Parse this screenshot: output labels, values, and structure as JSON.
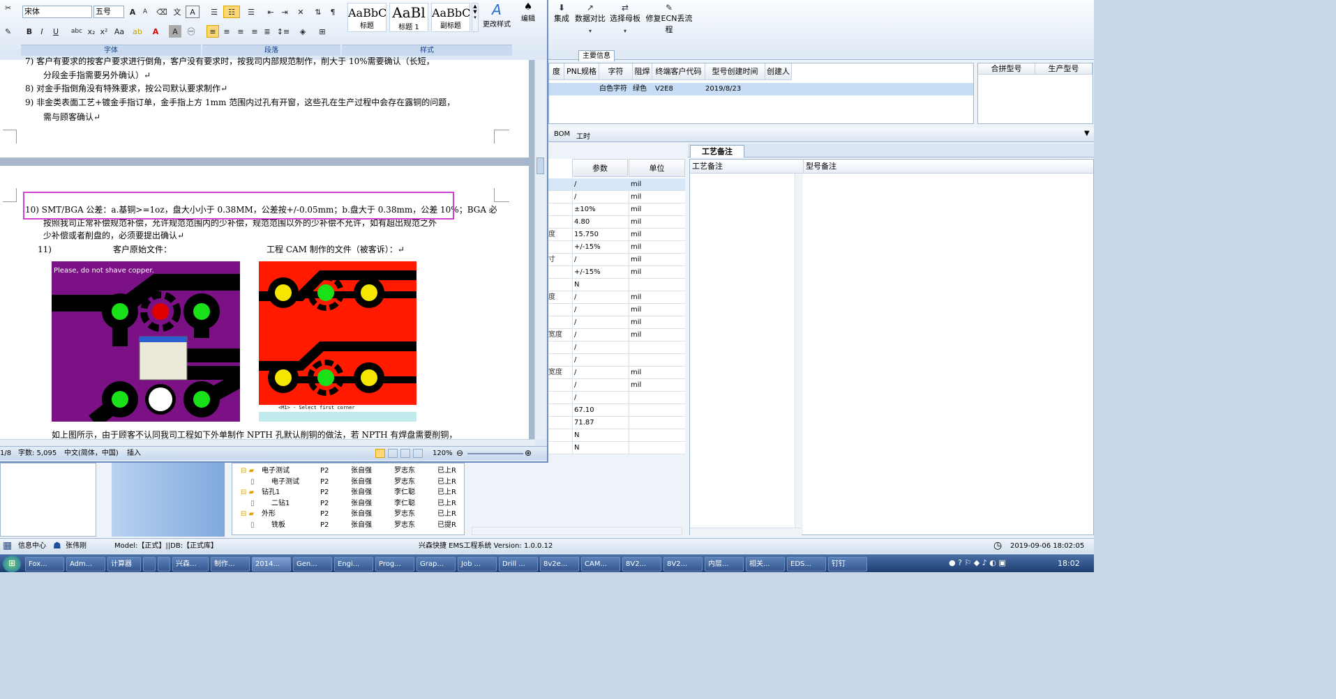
{
  "background_app": {
    "ribbon_buttons": [
      "集成",
      "数据对比",
      "选择母板",
      "修复ECN丢流程"
    ],
    "main_info_tab": "主要信息",
    "grid1_headers": [
      "度",
      "PNL规格",
      "字符",
      "阻焊",
      "终端客户代码",
      "型号创建时间",
      "创建人"
    ],
    "grid1_row": {
      "char": "白色字符",
      "mask": "绿色",
      "customer": "V2E8",
      "created": "2019/8/23"
    },
    "grid2_headers": [
      "合拼型号",
      "生产型号"
    ],
    "bom_tabs": [
      "BOM",
      "工时"
    ],
    "param_headers": [
      "参数",
      "单位"
    ],
    "param_rows": [
      {
        "name": "",
        "value": "/",
        "unit": "mil"
      },
      {
        "name": "",
        "value": "/",
        "unit": "mil"
      },
      {
        "name": "",
        "value": "±10%",
        "unit": "mil"
      },
      {
        "name": "",
        "value": "4.80",
        "unit": "mil"
      },
      {
        "name": "度",
        "value": "15.750",
        "unit": "mil"
      },
      {
        "name": "",
        "value": "+/-15%",
        "unit": "mil"
      },
      {
        "name": "寸",
        "value": "/",
        "unit": "mil"
      },
      {
        "name": "",
        "value": "+/-15%",
        "unit": "mil"
      },
      {
        "name": "",
        "value": "N",
        "unit": ""
      },
      {
        "name": "度",
        "value": "/",
        "unit": "mil"
      },
      {
        "name": "",
        "value": "/",
        "unit": "mil"
      },
      {
        "name": "",
        "value": "/",
        "unit": "mil"
      },
      {
        "name": "宽度",
        "value": "/",
        "unit": "mil"
      },
      {
        "name": "",
        "value": "/",
        "unit": ""
      },
      {
        "name": "",
        "value": "/",
        "unit": ""
      },
      {
        "name": "宽度",
        "value": "/",
        "unit": "mil"
      },
      {
        "name": "",
        "value": "/",
        "unit": "mil"
      },
      {
        "name": "",
        "value": "/",
        "unit": ""
      },
      {
        "name": "",
        "value": "67.10",
        "unit": ""
      },
      {
        "name": "",
        "value": "71.87",
        "unit": ""
      },
      {
        "name": "",
        "value": "N",
        "unit": ""
      },
      {
        "name": "",
        "value": "N",
        "unit": ""
      }
    ],
    "note_tab": "工艺备注",
    "note_headers": [
      "工艺备注",
      "型号备注"
    ],
    "tree_rows": [
      {
        "indent": 0,
        "name": "电子测试",
        "code": "P2",
        "p1": "张自强",
        "p2": "罗志东",
        "st": "已上R"
      },
      {
        "indent": 1,
        "name": "电子测试",
        "code": "P2",
        "p1": "张自强",
        "p2": "罗志东",
        "st": "已上R"
      },
      {
        "indent": 0,
        "name": "钻孔1",
        "code": "P2",
        "p1": "张自强",
        "p2": "李仁聪",
        "st": "已上R"
      },
      {
        "indent": 1,
        "name": "二钻1",
        "code": "P2",
        "p1": "张自强",
        "p2": "李仁聪",
        "st": "已上R"
      },
      {
        "indent": 0,
        "name": "外形",
        "code": "P2",
        "p1": "张自强",
        "p2": "罗志东",
        "st": "已上R"
      },
      {
        "indent": 1,
        "name": "铣板",
        "code": "P2",
        "p1": "张自强",
        "p2": "罗志东",
        "st": "已提R"
      }
    ],
    "status": {
      "info": "信息中心",
      "user": "张伟刚",
      "model": "Model:【正式】||DB:【正式库】",
      "system": "兴森快捷 EMS工程系统 Version: 1.0.0.12",
      "datetime": "2019-09-06 18:02:05"
    }
  },
  "word": {
    "font_name": "宋体",
    "font_size": "五号",
    "styles": [
      {
        "sample": "AaBbC",
        "name": "标题"
      },
      {
        "sample": "AaBl",
        "name": "标题 1"
      },
      {
        "sample": "AaBbC",
        "name": "副标题"
      }
    ],
    "change_styles": "更改样式",
    "edit": "编辑",
    "groups": [
      "字体",
      "段落",
      "样式"
    ],
    "lines": {
      "l7a": "7)   客户有要求的按客户要求进行倒角，客户没有要求时，按我司内部规范制作，削大于 10%需要确认（长短，",
      "l7b": "分段金手指需要另外确认）↵",
      "l8": "8)   对金手指倒角没有特殊要求，按公司默认要求制作↵",
      "l9a": "9)   非金类表面工艺+镀金手指订单，金手指上方 1mm 范围内过孔有开窗，这些孔在生产过程中会存在露铜的问题，",
      "l9b": "需与顾客确认↵",
      "l10a": "10) SMT/BGA 公差：a.基铜>=1oz，盘大小小于 0.38MM，公差按+/-0.05mm；b.盘大于 0.38mm，公差 10%；BGA 必须",
      "l10b": "按照我司正常补偿规范补偿，允许规范范围内的少补偿，规范范围以外的少补偿不允许，如有超出规范之外",
      "l10c": "少补偿或者削盘的，必须要提出确认↵",
      "l11a": "11)",
      "l11b": "客户原始文件：",
      "l11c": "工程 CAM 制作的文件（被客诉）：↵",
      "l12": "如上图所示，由于顾客不认同我司工程如下外单制作 NPTH 孔默认削铜的做法，若 NPTH 有焊盘需要削铜，"
    },
    "img1_note": "Please, do not shave copper.",
    "img2_cmd": "<M1> - Select first corner",
    "status": {
      "page": "1/8",
      "words": "字数: 5,095",
      "lang": "中文(简体，中国)",
      "mode": "插入",
      "zoom": "120%"
    }
  },
  "taskbar": {
    "items": [
      "Fox...",
      "Adm...",
      "计算器",
      "",
      "",
      "兴森...",
      "制作...",
      "2014...",
      "Gen...",
      "Engi...",
      "Prog...",
      "Grap...",
      "Job ...",
      "Drill ...",
      "8v2e...",
      "CAM...",
      "8V2...",
      "8V2...",
      "内层...",
      "相关...",
      "EDS...",
      "钉钉"
    ],
    "clock": "18:02"
  },
  "colors": {
    "highlight": "#d43fd4",
    "purple": "#7b1185",
    "red": "#ff1a00"
  }
}
